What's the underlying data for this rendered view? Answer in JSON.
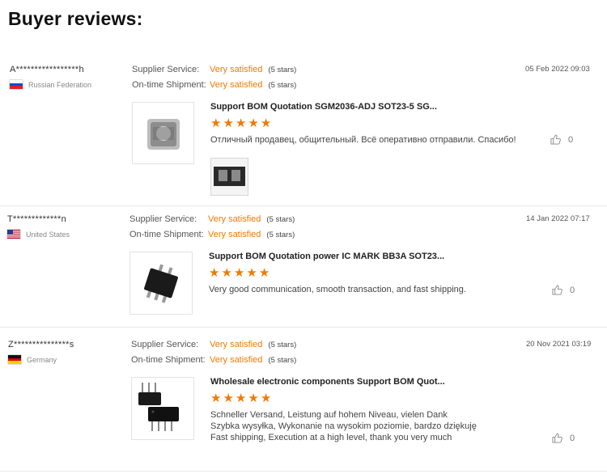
{
  "page": {
    "title": "Buyer reviews:"
  },
  "reviews": [
    {
      "user": "A*****************h",
      "country": "Russian Federation",
      "flag": "russia-flag-icon",
      "service_label": "Supplier Service:",
      "service_value": "Very satisfied",
      "service_stars": "(5 stars)",
      "shipment_label": "On-time Shipment:",
      "shipment_value": "Very satisfied",
      "shipment_stars": "(5 stars)",
      "date": "05 Feb 2022 09:03",
      "product_title": "Support BOM Quotation SGM2036-ADJ SOT23-5 SG...",
      "rating": 5,
      "text": [
        "Отличный продавец, общительный. Всё оперативно отправили. Спасибо!"
      ],
      "likes": "0"
    },
    {
      "user": "T*************n",
      "country": "United States",
      "flag": "usa-flag-icon",
      "service_label": "Supplier Service:",
      "service_value": "Very satisfied",
      "service_stars": "(5 stars)",
      "shipment_label": "On-time Shipment:",
      "shipment_value": "Very satisfied",
      "shipment_stars": "(5 stars)",
      "date": "14 Jan 2022 07:17",
      "product_title": "Support BOM Quotation power IC MARK BB3A SOT23...",
      "rating": 5,
      "text": [
        "Very good communication, smooth transaction, and fast shipping."
      ],
      "likes": "0"
    },
    {
      "user": "Z***************s",
      "country": "Germany",
      "flag": "germany-flag-icon",
      "service_label": "Supplier Service:",
      "service_value": "Very satisfied",
      "service_stars": "(5 stars)",
      "shipment_label": "On-time Shipment:",
      "shipment_value": "Very satisfied",
      "shipment_stars": "(5 stars)",
      "date": "20 Nov 2021 03:19",
      "product_title": "Wholesale electronic components Support BOM Quot...",
      "rating": 5,
      "text": [
        "Schneller Versand, Leistung auf hohem Niveau, vielen Dank",
        "Szybka wysyłka, Wykonanie na wysokim poziomie, bardzo dziękuję",
        "Fast shipping, Execution at a high level, thank you very much"
      ],
      "likes": "0"
    }
  ],
  "colors": {
    "accent": "#f27a00",
    "separator": "#e8e8e8"
  }
}
